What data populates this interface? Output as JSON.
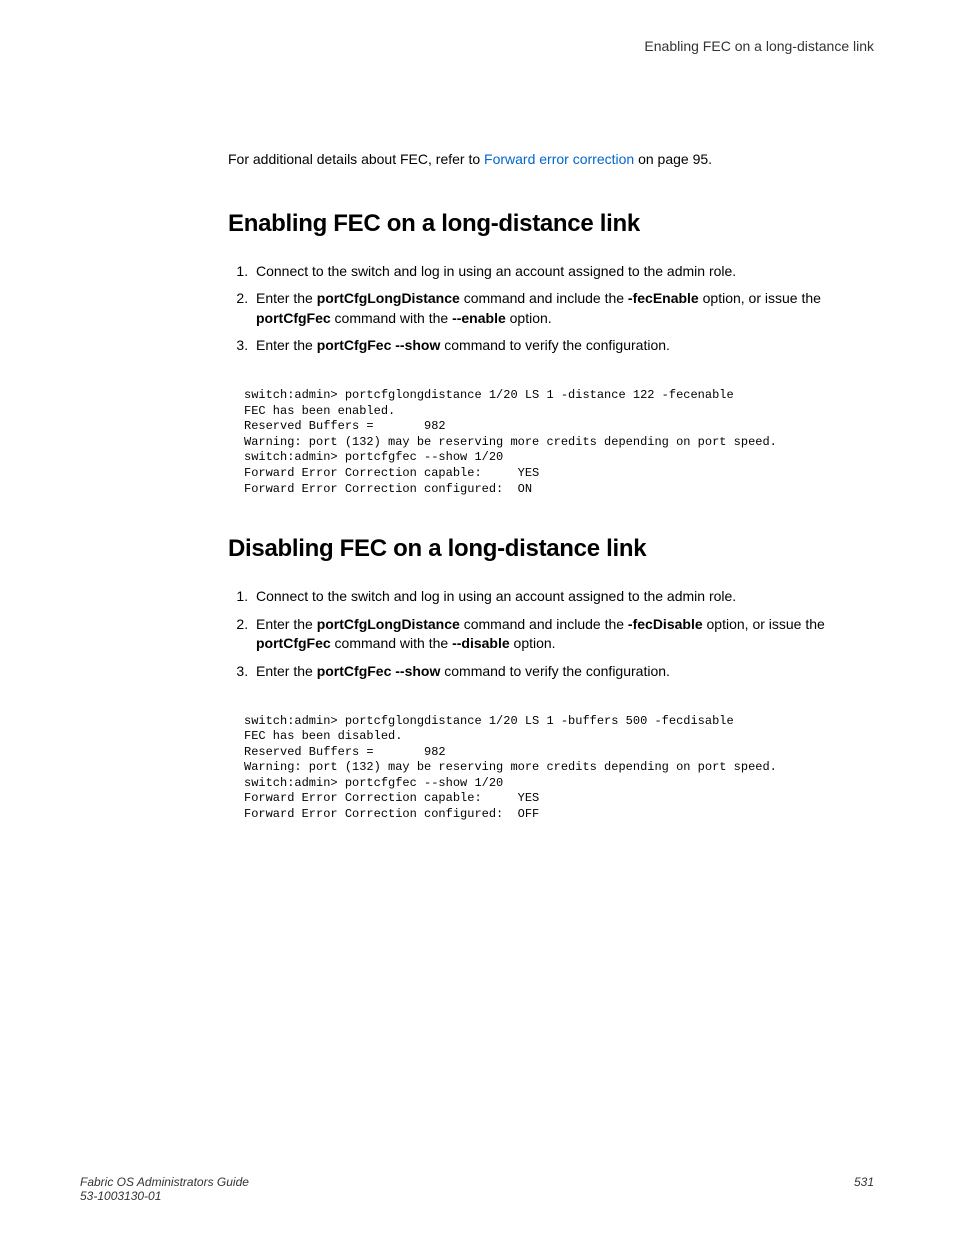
{
  "header": {
    "section_title": "Enabling FEC on a long-distance link"
  },
  "intro": {
    "prefix": "For additional details about FEC, refer to ",
    "link_text": "Forward error correction",
    "suffix": " on page 95."
  },
  "enabling": {
    "heading": "Enabling FEC on a long-distance link",
    "steps": {
      "s1": "Connect to the switch and log in using an account assigned to the admin role.",
      "s2_a": "Enter the ",
      "s2_cmd1": "portCfgLongDistance",
      "s2_b": " command and include the ",
      "s2_cmd2": "-fecEnable",
      "s2_c": " option, or issue the ",
      "s2_cmd3": "portCfgFec",
      "s2_d": " command with the ",
      "s2_cmd4": "--enable",
      "s2_e": " option.",
      "s3_a": "Enter the ",
      "s3_cmd1": "portCfgFec --show",
      "s3_b": " command to verify the configuration."
    },
    "code": "switch:admin> portcfglongdistance 1/20 LS 1 -distance 122 -fecenable\nFEC has been enabled.\nReserved Buffers =       982\nWarning: port (132) may be reserving more credits depending on port speed.\nswitch:admin> portcfgfec --show 1/20\nForward Error Correction capable:     YES\nForward Error Correction configured:  ON"
  },
  "disabling": {
    "heading": "Disabling FEC on a long-distance link",
    "steps": {
      "s1": "Connect to the switch and log in using an account assigned to the admin role.",
      "s2_a": "Enter the ",
      "s2_cmd1": "portCfgLongDistance",
      "s2_b": " command and include the ",
      "s2_cmd2": "-fecDisable",
      "s2_c": " option, or issue the ",
      "s2_cmd3": "portCfgFec",
      "s2_d": " command with the ",
      "s2_cmd4": "--disable",
      "s2_e": " option.",
      "s3_a": "Enter the ",
      "s3_cmd1": "portCfgFec --show",
      "s3_b": " command to verify the configuration."
    },
    "code": "switch:admin> portcfglongdistance 1/20 LS 1 -buffers 500 -fecdisable\nFEC has been disabled.\nReserved Buffers =       982\nWarning: port (132) may be reserving more credits depending on port speed.\nswitch:admin> portcfgfec --show 1/20\nForward Error Correction capable:     YES\nForward Error Correction configured:  OFF"
  },
  "footer": {
    "title": "Fabric OS Administrators Guide",
    "docnum": "53-1003130-01",
    "page": "531"
  }
}
